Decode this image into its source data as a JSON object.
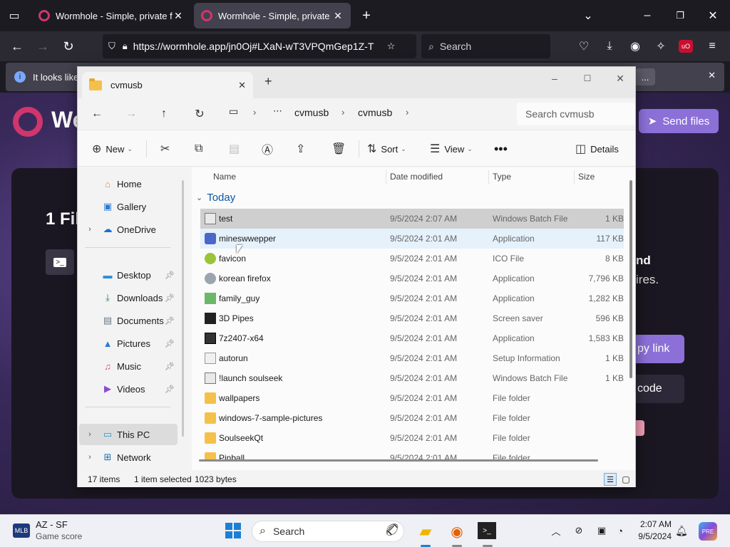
{
  "browser": {
    "tabs": [
      {
        "title": "Wormhole - Simple, private file"
      },
      {
        "title": "Wormhole - Simple, private file"
      }
    ],
    "url": "https://wormhole.app/jn0Oj#LXaN-wT3VPQmGep1Z-T",
    "search_placeholder": "Search",
    "notification_text": "It looks like"
  },
  "site": {
    "logo_text": "We",
    "heading_fragment": "1 Fil",
    "right_fragment_1": "nd",
    "right_fragment_2": "ires.",
    "send_button": "Send files",
    "copy_link_fragment": "py link",
    "code_fragment": "code",
    "terminal_icon": ">_"
  },
  "explorer": {
    "tab_title": "cvmusb",
    "breadcrumb": [
      "cvmusb",
      "cvmusb"
    ],
    "search_placeholder": "Search cvmusb",
    "toolbar": {
      "new": "New",
      "sort": "Sort",
      "view": "View",
      "details": "Details"
    },
    "sidebar": [
      {
        "label": "Home",
        "icon": "home-icon"
      },
      {
        "label": "Gallery",
        "icon": "gallery-icon"
      },
      {
        "label": "OneDrive",
        "icon": "onedrive-icon"
      },
      {
        "label": "Desktop",
        "icon": "desktop-icon"
      },
      {
        "label": "Downloads",
        "icon": "downloads-icon"
      },
      {
        "label": "Documents",
        "icon": "documents-icon"
      },
      {
        "label": "Pictures",
        "icon": "pictures-icon"
      },
      {
        "label": "Music",
        "icon": "music-icon"
      },
      {
        "label": "Videos",
        "icon": "videos-icon"
      },
      {
        "label": "This PC",
        "icon": "this-pc-icon"
      },
      {
        "label": "Network",
        "icon": "network-icon"
      }
    ],
    "columns": {
      "name": "Name",
      "date": "Date modified",
      "type": "Type",
      "size": "Size"
    },
    "group": "Today",
    "files": [
      {
        "name": "test",
        "date": "9/5/2024 2:07 AM",
        "type": "Windows Batch File",
        "size": "1 KB"
      },
      {
        "name": "mineswwepper",
        "date": "9/5/2024 2:01 AM",
        "type": "Application",
        "size": "117 KB"
      },
      {
        "name": "favicon",
        "date": "9/5/2024 2:01 AM",
        "type": "ICO File",
        "size": "8 KB"
      },
      {
        "name": "korean firefox",
        "date": "9/5/2024 2:01 AM",
        "type": "Application",
        "size": "7,796 KB"
      },
      {
        "name": "family_guy",
        "date": "9/5/2024 2:01 AM",
        "type": "Application",
        "size": "1,282 KB"
      },
      {
        "name": "3D Pipes",
        "date": "9/5/2024 2:01 AM",
        "type": "Screen saver",
        "size": "596 KB"
      },
      {
        "name": "7z2407-x64",
        "date": "9/5/2024 2:01 AM",
        "type": "Application",
        "size": "1,583 KB"
      },
      {
        "name": "autorun",
        "date": "9/5/2024 2:01 AM",
        "type": "Setup Information",
        "size": "1 KB"
      },
      {
        "name": "!launch soulseek",
        "date": "9/5/2024 2:01 AM",
        "type": "Windows Batch File",
        "size": "1 KB"
      },
      {
        "name": "wallpapers",
        "date": "9/5/2024 2:01 AM",
        "type": "File folder",
        "size": ""
      },
      {
        "name": "windows-7-sample-pictures",
        "date": "9/5/2024 2:01 AM",
        "type": "File folder",
        "size": ""
      },
      {
        "name": "SoulseekQt",
        "date": "9/5/2024 2:01 AM",
        "type": "File folder",
        "size": ""
      },
      {
        "name": "Pinball",
        "date": "9/5/2024 2:01 AM",
        "type": "File folder",
        "size": ""
      }
    ],
    "status": {
      "items": "17 items",
      "selected": "1 item selected",
      "bytes": "1023 bytes"
    }
  },
  "taskbar": {
    "widget_title": "AZ - SF",
    "widget_sub": "Game score",
    "search_placeholder": "Search",
    "time": "2:07 AM",
    "date": "9/5/2024"
  }
}
